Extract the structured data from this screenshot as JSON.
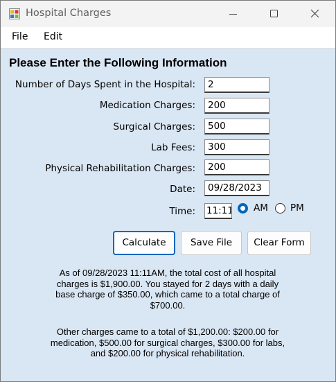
{
  "window": {
    "title": "Hospital Charges"
  },
  "menu": {
    "file": "File",
    "edit": "Edit"
  },
  "form": {
    "heading": "Please Enter the Following Information",
    "days_label": "Number of Days Spent in the Hospital:",
    "days_value": "2",
    "medication_label": "Medication Charges:",
    "medication_value": "200",
    "surgical_label": "Surgical Charges:",
    "surgical_value": "500",
    "lab_label": "Lab Fees:",
    "lab_value": "300",
    "rehab_label": "Physical Rehabilitation Charges:",
    "rehab_value": "200",
    "date_label": "Date:",
    "date_value": "09/28/2023",
    "time_label": "Time:",
    "time_value": "11:11",
    "am_label": "AM",
    "pm_label": "PM",
    "selected_period": "AM"
  },
  "buttons": {
    "calculate": "Calculate",
    "save": "Save File",
    "clear": "Clear Form"
  },
  "summary": {
    "line1": "As of 09/28/2023 11:11AM, the total cost of all hospital",
    "line2": "charges is $1,900.00. You stayed for 2 days with a daily",
    "line3": "base charge of $350.00, which came to a total charge of",
    "line4": "$700.00.",
    "line5": "Other charges came to a total of $1,200.00: $200.00 for",
    "line6": "medication, $500.00 for surgical charges, $300.00 for labs,",
    "line7": "and $200.00 for physical rehabilitation."
  },
  "icons": {
    "app": "app-window-icon",
    "minimize": "minimize-icon",
    "maximize": "maximize-icon",
    "close": "close-icon"
  },
  "colors": {
    "form_background": "#d9e6f3",
    "accent": "#0067c0"
  }
}
